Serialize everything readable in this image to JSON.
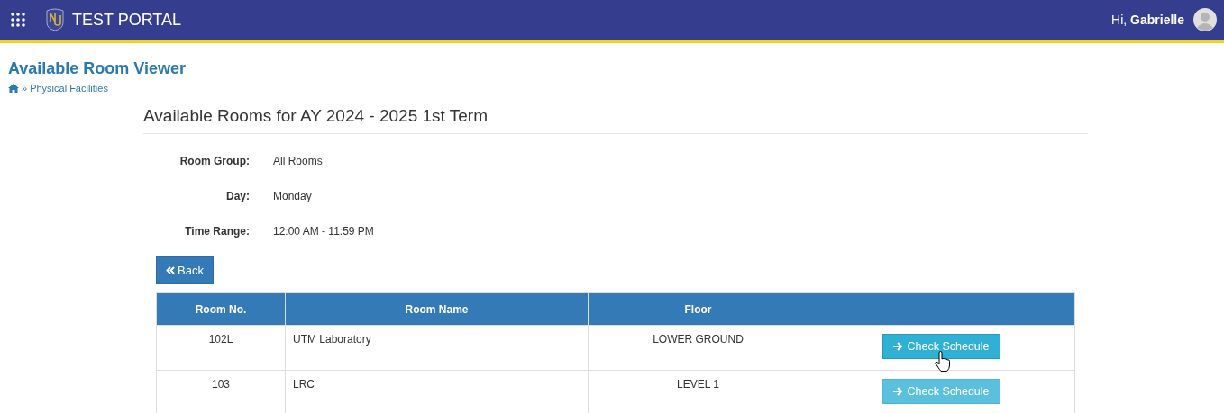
{
  "header": {
    "title": "TEST PORTAL",
    "greeting": "Hi,",
    "user": "Gabrielle"
  },
  "page_title": "Available Room Viewer",
  "breadcrumb": {
    "separator": "»",
    "link": "Physical Facilities"
  },
  "section_title": "Available Rooms for AY 2024 - 2025 1st Term",
  "details": [
    {
      "label": "Room Group:",
      "value": "All Rooms"
    },
    {
      "label": "Day:",
      "value": "Monday"
    },
    {
      "label": "Time Range:",
      "value": "12:00 AM - 11:59 PM"
    }
  ],
  "back_button": "Back",
  "table": {
    "columns": [
      "Room No.",
      "Room Name",
      "Floor"
    ],
    "rows": [
      {
        "room_no": "102L",
        "room_name": "UTM Laboratory",
        "floor": "LOWER GROUND",
        "action": "Check Schedule",
        "hovered": true
      },
      {
        "room_no": "103",
        "room_name": "LRC",
        "floor": "LEVEL 1",
        "action": "Check Schedule",
        "hovered": false
      }
    ]
  }
}
